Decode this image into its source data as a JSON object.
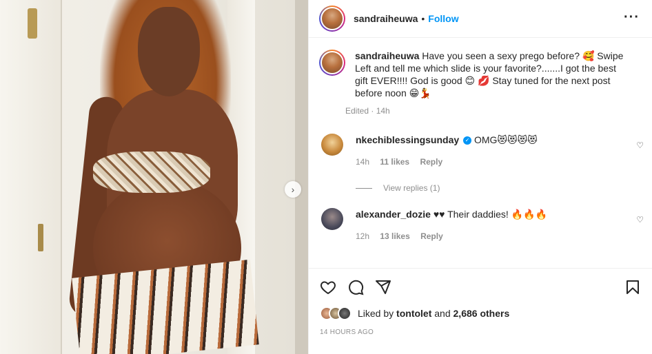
{
  "post": {
    "username": "sandraiheuwa",
    "separator": "•",
    "follow_label": "Follow",
    "more_icon": "more-horizontal-icon"
  },
  "caption": {
    "username": "sandraiheuwa",
    "text": "Have you seen a sexy prego before? 🥰 Swipe Left and tell me which slide is your favorite?.......I got the best gift EVER!!!! God is good 😊 💋 Stay tuned for the next post before noon 😁💃",
    "meta": "Edited · 14h"
  },
  "comments": [
    {
      "username": "nkechiblessingsunday",
      "verified": true,
      "text": "OMG😻😻😻😻",
      "time": "14h",
      "likes": "11 likes",
      "reply": "Reply",
      "avatar_color": "#c98a3d"
    },
    {
      "username": "alexander_dozie",
      "verified": false,
      "text": "♥♥ Their daddies! 🔥🔥🔥",
      "time": "12h",
      "likes": "13 likes",
      "reply": "Reply",
      "avatar_color": "#4a4a5a"
    }
  ],
  "view_replies": "View replies (1)",
  "actions": {
    "like_icon": "heart-icon",
    "comment_icon": "comment-icon",
    "share_icon": "send-icon",
    "save_icon": "bookmark-icon"
  },
  "likes": {
    "prefix": "Liked by",
    "user": "tontolet",
    "middle": "and",
    "others": "2,686 others"
  },
  "timestamp": "14 HOURS AGO",
  "carousel": {
    "next_icon": "chevron-right-icon",
    "next_glyph": "›"
  },
  "colors": {
    "accent": "#0095f6",
    "muted": "#8e8e8e",
    "text": "#262626"
  }
}
